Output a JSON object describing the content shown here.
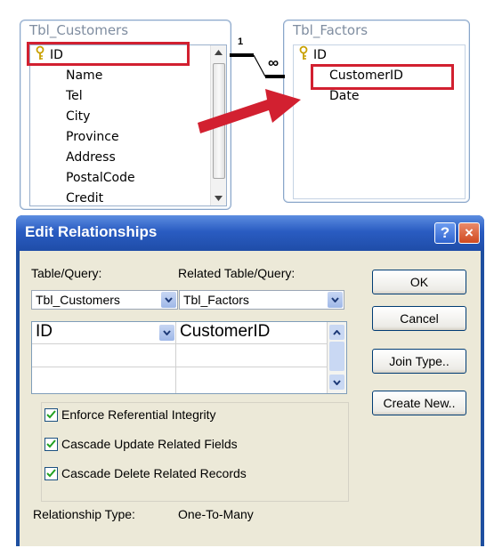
{
  "tables": {
    "customers": {
      "title": "Tbl_Customers",
      "fields": [
        "ID",
        "Name",
        "Tel",
        "City",
        "Province",
        "Address",
        "PostalCode",
        "Credit"
      ]
    },
    "factors": {
      "title": "Tbl_Factors",
      "fields": [
        "ID",
        "CustomerID",
        "Date"
      ]
    }
  },
  "relationship_line": {
    "one_label": "1",
    "many_label": "∞"
  },
  "dialog": {
    "title": "Edit Relationships",
    "help_label": "?",
    "close_label": "×",
    "table_label": "Table/Query:",
    "related_label": "Related Table/Query:",
    "table_value": "Tbl_Customers",
    "related_value": "Tbl_Factors",
    "grid_rows": [
      {
        "left": "ID",
        "right": "CustomerID"
      }
    ],
    "buttons": {
      "ok": "OK",
      "cancel": "Cancel",
      "join_type": "Join Type..",
      "create_new": "Create New.."
    },
    "options": [
      {
        "label": "Enforce Referential Integrity",
        "checked": true
      },
      {
        "label": "Cascade Update Related Fields",
        "checked": true
      },
      {
        "label": "Cascade Delete Related Records",
        "checked": true
      }
    ],
    "relationship_type_label": "Relationship Type:",
    "relationship_type_value": "One-To-Many"
  },
  "colors": {
    "highlight": "#d22030",
    "titlebar": "#2a5cc2",
    "dialog_body": "#ece9d8",
    "check": "#21a121"
  }
}
